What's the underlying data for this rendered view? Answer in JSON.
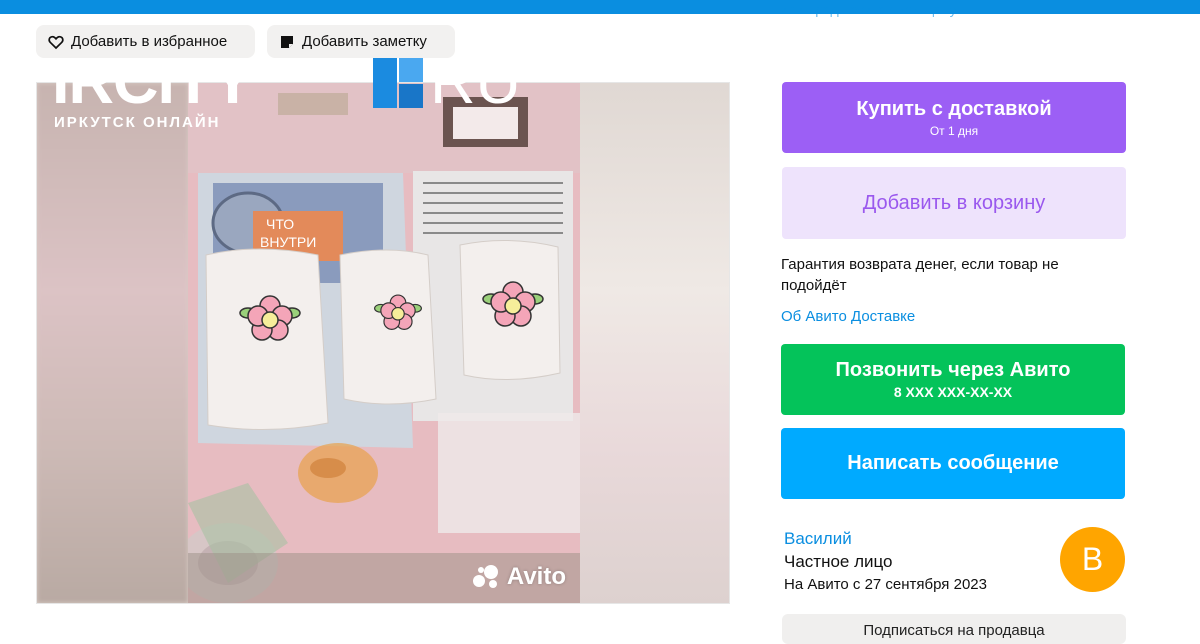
{
  "header": {
    "cut_text": "или предложите свою цену"
  },
  "actions": {
    "favorite_label": "Добавить в избранное",
    "note_label": "Добавить заметку"
  },
  "watermark": {
    "brand_left": "IRCITY",
    "brand_right": "RU",
    "subtitle": "ИРКУТСК ОНЛАЙН"
  },
  "gallery": {
    "watermark": "Avito",
    "book_title_line1": "ЧТО",
    "book_title_line2": "ВНУТРИ"
  },
  "purchase": {
    "buy_label": "Купить с доставкой",
    "buy_sub": "От 1 дня",
    "cart_label": "Добавить в корзину",
    "guarantee": "Гарантия возврата денег, если товар не подойдёт",
    "delivery_link": "Об Авито Доставке"
  },
  "contact": {
    "call_label": "Позвонить через Авито",
    "call_phone": "8 XXX XXX-XX-XX",
    "message_label": "Написать сообщение"
  },
  "seller": {
    "name": "Василий",
    "type": "Частное лицо",
    "since": "На Авито с 27 сентября 2023",
    "avatar_letter": "В",
    "subscribe_label": "Подписаться на продавца"
  },
  "colors": {
    "accent_blue": "#0a8ee0",
    "buy_purple": "#9c5ff5",
    "cart_lilac": "#eee3fc",
    "call_green": "#04c35a",
    "message_blue": "#00aaff",
    "avatar_orange": "#ffa500"
  }
}
